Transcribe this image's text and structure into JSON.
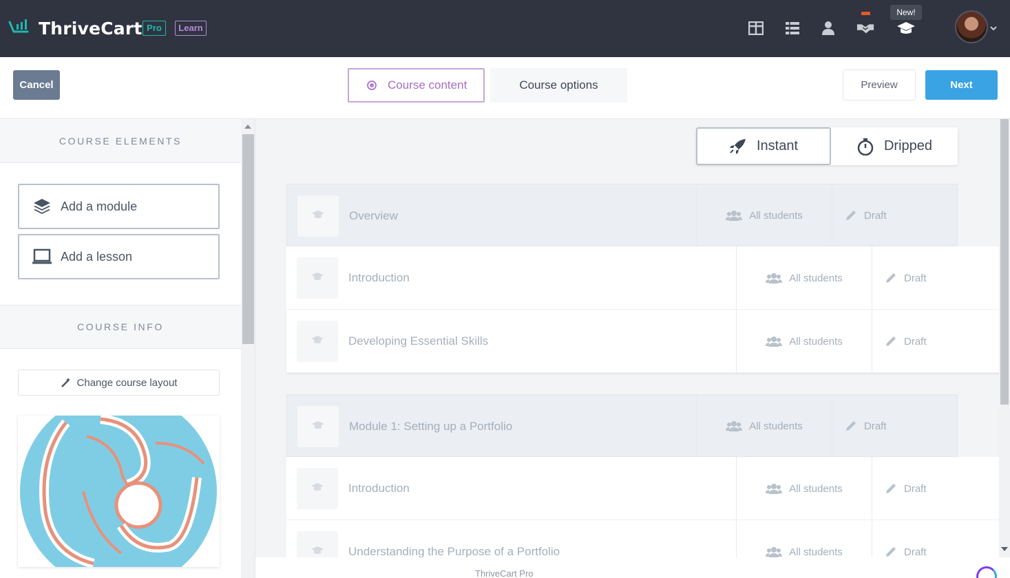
{
  "app": {
    "logo_text": "ThriveCart",
    "badge_pro": "Pro",
    "badge_learn": "Learn",
    "new_tag": "New!",
    "nav_icons": [
      "dashboard-icon",
      "list-icon",
      "user-icon",
      "handshake-icon",
      "graduation-cap-icon"
    ]
  },
  "header": {
    "cancel_label": "Cancel",
    "tabs": [
      {
        "label": "Course content",
        "active": true
      },
      {
        "label": "Course options",
        "active": false
      }
    ],
    "preview_label": "Preview",
    "next_label": "Next"
  },
  "sidebar": {
    "elements_title": "COURSE ELEMENTS",
    "add_module": "Add a module",
    "add_lesson": "Add a lesson",
    "info_title": "COURSE INFO",
    "change_layout": "Change course layout"
  },
  "release": {
    "instant": "Instant",
    "dripped": "Dripped",
    "selected": "Instant"
  },
  "modules": [
    {
      "title": "Overview",
      "access": "All students",
      "status": "Draft",
      "lessons": [
        {
          "title": "Introduction",
          "access": "All students",
          "status": "Draft"
        },
        {
          "title": "Developing Essential Skills",
          "access": "All students",
          "status": "Draft"
        }
      ]
    },
    {
      "title": "Module 1: Setting up a Portfolio",
      "access": "All students",
      "status": "Draft",
      "lessons": [
        {
          "title": "Introduction",
          "access": "All students",
          "status": "Draft"
        },
        {
          "title": "Understanding the Purpose of a Portfolio",
          "access": "All students",
          "status": "Draft"
        }
      ]
    }
  ],
  "footer": {
    "text": "ThriveCart Pro"
  },
  "colors": {
    "topbar": "#2f3440",
    "accent_blue": "#3aa3e3",
    "accent_purple": "#a66dc6",
    "teal": "#1fb8b0"
  }
}
